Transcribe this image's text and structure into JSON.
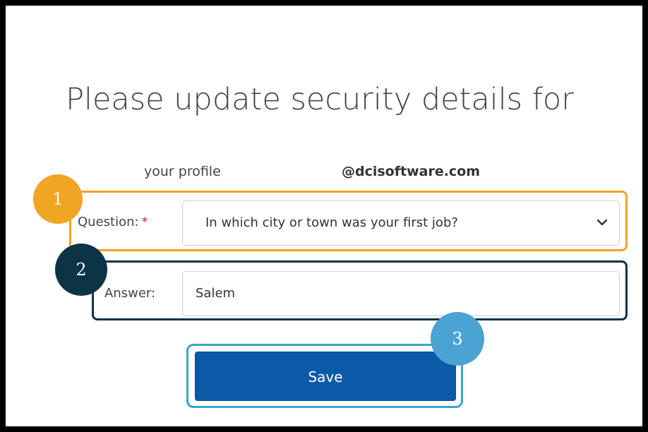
{
  "form": {
    "title": "Please update security details for",
    "profile_label": "your profile",
    "email": "@dcisoftware.com",
    "question_label": "Question:",
    "required_mark": "*",
    "question_value": "In which city or town was your first job?",
    "answer_label": "Answer:",
    "answer_value": "Salem",
    "save_label": "Save"
  },
  "callouts": {
    "one": "1",
    "two": "2",
    "three": "3"
  },
  "colors": {
    "callout_1": "#f0a523",
    "callout_2": "#0d3347",
    "callout_3": "#4aa3d3",
    "save_button": "#0b5aa8"
  },
  "icons": {
    "select_arrow": "chevron-down-icon"
  }
}
